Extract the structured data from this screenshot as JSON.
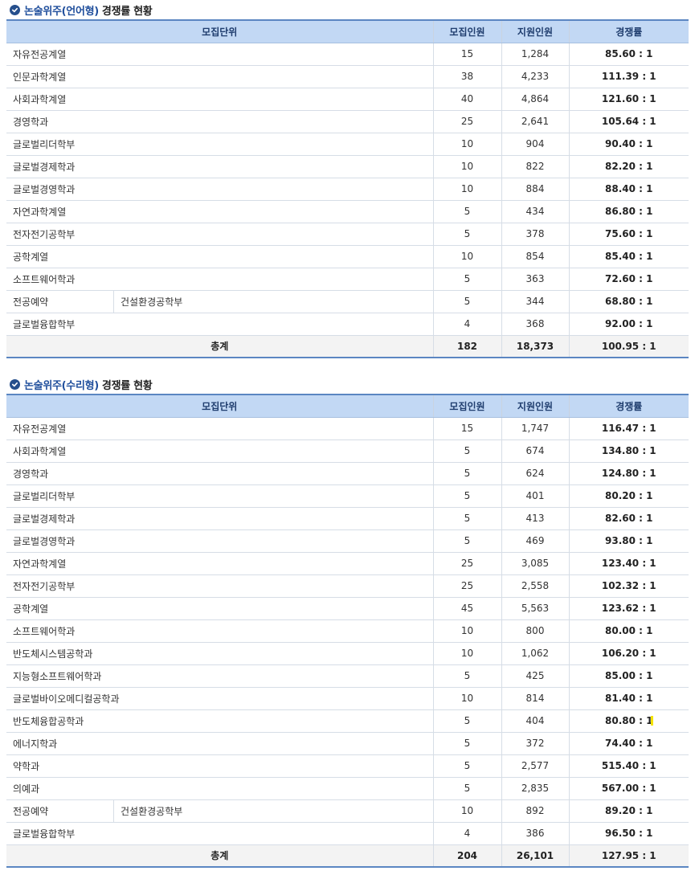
{
  "sections": [
    {
      "title_highlight": "논술위주(언어형)",
      "title_rest": "경쟁률 현황",
      "headers": [
        "모집단위",
        "모집인원",
        "지원인원",
        "경쟁률"
      ],
      "rows": [
        {
          "unit": "자유전공계열",
          "quota": "15",
          "applicants": "1,284",
          "rate": "85.60 : 1"
        },
        {
          "unit": "인문과학계열",
          "quota": "38",
          "applicants": "4,233",
          "rate": "111.39 : 1"
        },
        {
          "unit": "사회과학계열",
          "quota": "40",
          "applicants": "4,864",
          "rate": "121.60 : 1"
        },
        {
          "unit": "경영학과",
          "quota": "25",
          "applicants": "2,641",
          "rate": "105.64 : 1"
        },
        {
          "unit": "글로벌리더학부",
          "quota": "10",
          "applicants": "904",
          "rate": "90.40 : 1"
        },
        {
          "unit": "글로벌경제학과",
          "quota": "10",
          "applicants": "822",
          "rate": "82.20 : 1"
        },
        {
          "unit": "글로벌경영학과",
          "quota": "10",
          "applicants": "884",
          "rate": "88.40 : 1"
        },
        {
          "unit": "자연과학계열",
          "quota": "5",
          "applicants": "434",
          "rate": "86.80 : 1"
        },
        {
          "unit": "전자전기공학부",
          "quota": "5",
          "applicants": "378",
          "rate": "75.60 : 1"
        },
        {
          "unit": "공학계열",
          "quota": "10",
          "applicants": "854",
          "rate": "85.40 : 1"
        },
        {
          "unit": "소프트웨어학과",
          "quota": "5",
          "applicants": "363",
          "rate": "72.60 : 1"
        },
        {
          "unit": "전공예약",
          "sub": "건설환경공학부",
          "quota": "5",
          "applicants": "344",
          "rate": "68.80 : 1"
        },
        {
          "unit": "글로벌융합학부",
          "quota": "4",
          "applicants": "368",
          "rate": "92.00 : 1"
        }
      ],
      "total": {
        "label": "총계",
        "quota": "182",
        "applicants": "18,373",
        "rate": "100.95 : 1"
      }
    },
    {
      "title_highlight": "논술위주(수리형)",
      "title_rest": "경쟁률 현황",
      "headers": [
        "모집단위",
        "모집인원",
        "지원인원",
        "경쟁률"
      ],
      "rows": [
        {
          "unit": "자유전공계열",
          "quota": "15",
          "applicants": "1,747",
          "rate": "116.47 : 1"
        },
        {
          "unit": "사회과학계열",
          "quota": "5",
          "applicants": "674",
          "rate": "134.80 : 1"
        },
        {
          "unit": "경영학과",
          "quota": "5",
          "applicants": "624",
          "rate": "124.80 : 1"
        },
        {
          "unit": "글로벌리더학부",
          "quota": "5",
          "applicants": "401",
          "rate": "80.20 : 1"
        },
        {
          "unit": "글로벌경제학과",
          "quota": "5",
          "applicants": "413",
          "rate": "82.60 : 1"
        },
        {
          "unit": "글로벌경영학과",
          "quota": "5",
          "applicants": "469",
          "rate": "93.80 : 1"
        },
        {
          "unit": "자연과학계열",
          "quota": "25",
          "applicants": "3,085",
          "rate": "123.40 : 1"
        },
        {
          "unit": "전자전기공학부",
          "quota": "25",
          "applicants": "2,558",
          "rate": "102.32 : 1"
        },
        {
          "unit": "공학계열",
          "quota": "45",
          "applicants": "5,563",
          "rate": "123.62 : 1"
        },
        {
          "unit": "소프트웨어학과",
          "quota": "10",
          "applicants": "800",
          "rate": "80.00 : 1"
        },
        {
          "unit": "반도체시스템공학과",
          "quota": "10",
          "applicants": "1,062",
          "rate": "106.20 : 1"
        },
        {
          "unit": "지능형소프트웨어학과",
          "quota": "5",
          "applicants": "425",
          "rate": "85.00 : 1"
        },
        {
          "unit": "글로벌바이오메디컬공학과",
          "quota": "10",
          "applicants": "814",
          "rate": "81.40 : 1"
        },
        {
          "unit": "반도체융합공학과",
          "quota": "5",
          "applicants": "404",
          "rate": "80.80 : 1"
        },
        {
          "unit": "에너지학과",
          "quota": "5",
          "applicants": "372",
          "rate": "74.40 : 1"
        },
        {
          "unit": "약학과",
          "quota": "5",
          "applicants": "2,577",
          "rate": "515.40 : 1"
        },
        {
          "unit": "의예과",
          "quota": "5",
          "applicants": "2,835",
          "rate": "567.00 : 1"
        },
        {
          "unit": "전공예약",
          "sub": "건설환경공학부",
          "quota": "10",
          "applicants": "892",
          "rate": "89.20 : 1"
        },
        {
          "unit": "글로벌융합학부",
          "quota": "4",
          "applicants": "386",
          "rate": "96.50 : 1"
        }
      ],
      "total": {
        "label": "총계",
        "quota": "204",
        "applicants": "26,101",
        "rate": "127.95 : 1"
      }
    }
  ],
  "colors": {
    "accent": "#1f4e9c",
    "header_bg": "#c2d8f4",
    "border": "#5b86c2",
    "total_bg": "#f3f3f3"
  },
  "icons": {
    "section_title": "check-circle-icon"
  }
}
